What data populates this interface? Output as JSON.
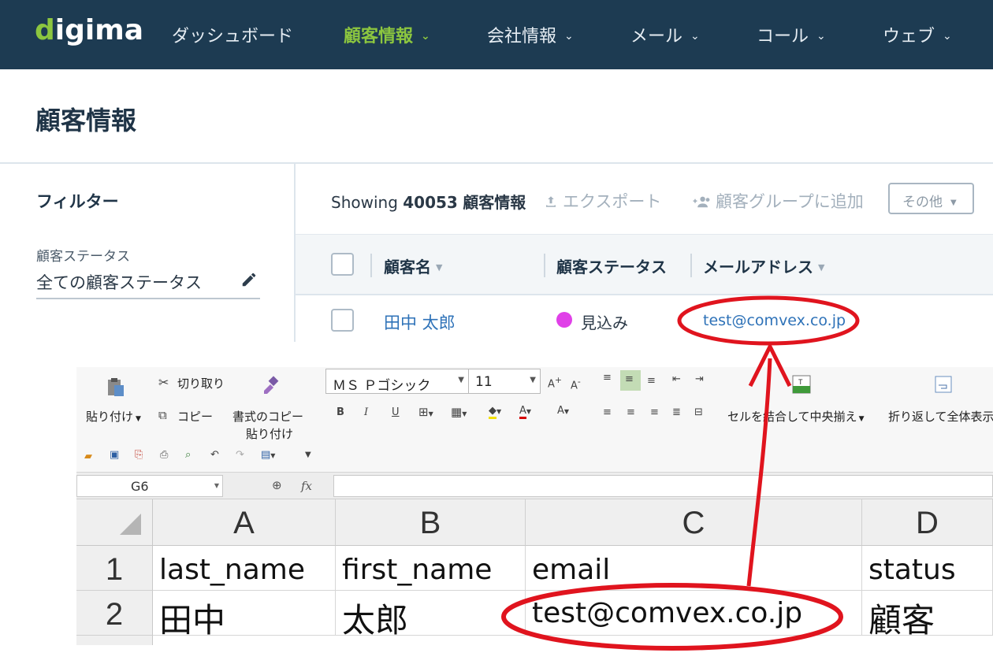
{
  "nav": {
    "logo": "digima",
    "items": [
      {
        "label": "ダッシュボード",
        "has_menu": false,
        "active": false
      },
      {
        "label": "顧客情報",
        "has_menu": true,
        "active": true
      },
      {
        "label": "会社情報",
        "has_menu": true,
        "active": false
      },
      {
        "label": "メール",
        "has_menu": true,
        "active": false
      },
      {
        "label": "コール",
        "has_menu": true,
        "active": false
      },
      {
        "label": "ウェブ",
        "has_menu": true,
        "active": false
      }
    ],
    "chevron": "⌄",
    "active_color": "#8cc63f",
    "bg_color": "#1d3b52"
  },
  "page": {
    "title": "顧客情報"
  },
  "filter": {
    "title": "フィルター",
    "status_label": "顧客ステータス",
    "status_value": "全ての顧客ステータス",
    "edit_icon": "pencil-icon"
  },
  "toolbar": {
    "showing_prefix": "Showing",
    "count": "40053",
    "entity": "顧客情報",
    "export_label": "エクスポート",
    "add_group_label": "顧客グループに追加",
    "more_label": "その他"
  },
  "table": {
    "columns": [
      "顧客名",
      "顧客ステータス",
      "メールアドレス"
    ],
    "rows": [
      {
        "name": "田中 太郎",
        "status": "見込み",
        "status_color": "#e040e8",
        "email": "test@comvex.co.jp"
      }
    ]
  },
  "excel": {
    "ribbon": {
      "cut": "切り取り",
      "paste": "貼り付け",
      "copy": "コピー",
      "format_copy_1": "書式のコピー",
      "format_copy_2": "貼り付け",
      "font_name": "ＭＳ Ｐゴシック",
      "font_size": "11",
      "merge_center": "セルを結合して中央揃え",
      "wrap": "折り返して全体表示"
    },
    "name_box": "G6",
    "fx": "fx",
    "columns": [
      "A",
      "B",
      "C",
      "D"
    ],
    "rows": [
      {
        "num": "1",
        "cells": [
          "last_name",
          "first_name",
          "email",
          "status"
        ]
      },
      {
        "num": "2",
        "cells": [
          "田中",
          "太郎",
          "test@comvex.co.jp",
          "顧客"
        ]
      }
    ]
  },
  "annotation_color": "#e0141e"
}
